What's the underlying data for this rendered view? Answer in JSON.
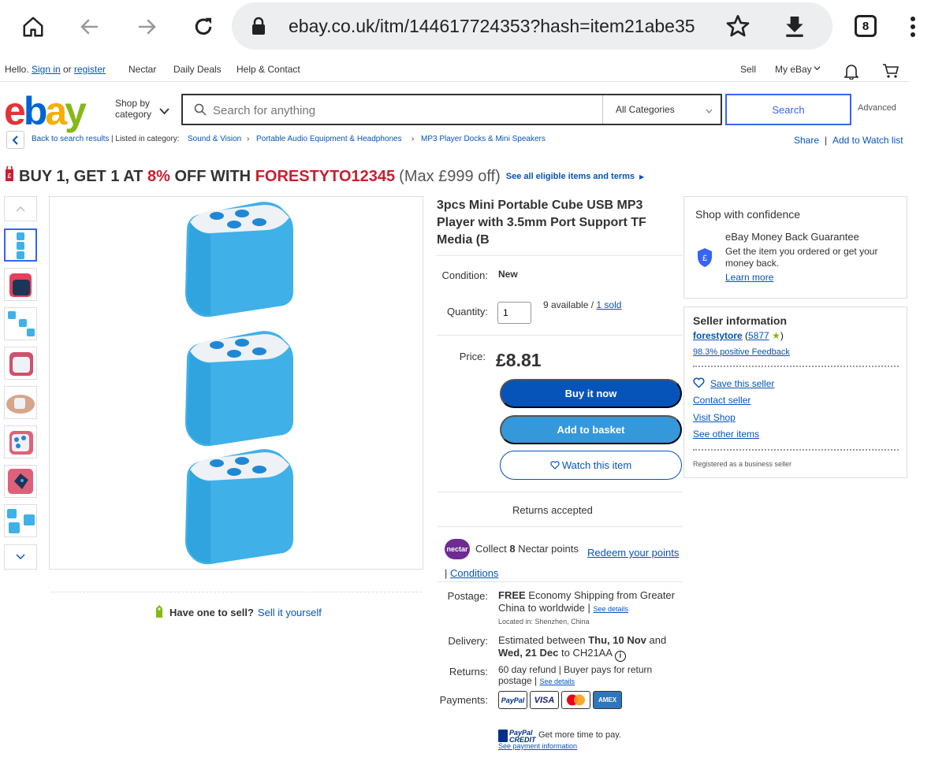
{
  "browser": {
    "url": "ebay.co.uk/itm/144617724353?hash=item21abe35",
    "tab_count": "8",
    "icons": [
      "home-icon",
      "back-arrow-icon",
      "forward-arrow-icon",
      "reload-icon",
      "lock-icon",
      "star-icon",
      "download-icon",
      "tabs-icon",
      "more-vert-icon"
    ]
  },
  "topnav": {
    "hello": "Hello.",
    "sign_in": "Sign in",
    "or": "or",
    "register": "register",
    "nectar": "Nectar",
    "daily_deals": "Daily Deals",
    "help": "Help & Contact",
    "sell": "Sell",
    "my_ebay": "My eBay"
  },
  "header": {
    "logo_letters": [
      "e",
      "b",
      "a",
      "y"
    ],
    "logo_colors": [
      "#e53238",
      "#0064d2",
      "#f5af02",
      "#86b817"
    ],
    "shop_by": "Shop by",
    "category": "category",
    "search_placeholder": "Search for anything",
    "all_categories": "All Categories",
    "search_button": "Search",
    "advanced": "Advanced"
  },
  "breadcrumb": {
    "back": "Back to search results",
    "listed_in": "Listed in category:",
    "items": [
      "Sound & Vision",
      "Portable Audio Equipment & Headphones",
      "MP3 Player Docks & Mini Speakers"
    ],
    "share": "Share",
    "watch": "Add to Watch list"
  },
  "promo": {
    "part1": "BUY 1, GET 1 AT",
    "pct": "8%",
    "part2": "OFF WITH",
    "code": "FORESTYTO12345",
    "max": "(Max £999 off)",
    "terms": "See all eligible items and terms"
  },
  "sell_banner": {
    "question": "Have one to sell?",
    "link": "Sell it yourself"
  },
  "item": {
    "title": "3pcs Mini Portable Cube USB MP3 Player with 3.5mm Port Support TF Media (B",
    "condition_label": "Condition:",
    "condition_value": "New",
    "quantity_label": "Quantity:",
    "quantity_value": "1",
    "available": "9 available /",
    "sold": "1 sold",
    "price_label": "Price:",
    "price": "£8.81",
    "buy_now": "Buy it now",
    "add_basket": "Add to basket",
    "watch": "Watch this item",
    "returns_accepted": "Returns accepted",
    "nectar_badge": "nectar",
    "nectar_collect": "Collect",
    "nectar_points": "8",
    "nectar_text": "Nectar points",
    "nectar_redeem": "Redeem your points",
    "nectar_conditions": "Conditions",
    "postage_label": "Postage:",
    "postage_free": "FREE",
    "postage_text": "Economy Shipping from Greater China to worldwide |",
    "postage_details": "See details",
    "located": "Located in: Shenzhen, China",
    "delivery_label": "Delivery:",
    "delivery_text1": "Estimated between",
    "delivery_date1": "Thu, 10 Nov",
    "delivery_and": "and",
    "delivery_date2": "Wed, 21 Dec",
    "delivery_to": "to CH21AA",
    "returns_label": "Returns:",
    "returns_text": "60 day refund | Buyer pays for return postage |",
    "returns_details": "See details",
    "payments_label": "Payments:",
    "payment_methods": [
      "PayPal",
      "VISA",
      "",
      "AMEX"
    ],
    "paypal_credit1": "PayPal",
    "paypal_credit2": "CREDIT",
    "paypal_more": "Get more time to pay.",
    "payment_info": "See payment information"
  },
  "confidence": {
    "title": "Shop with confidence",
    "guarantee": "eBay Money Back Guarantee",
    "desc": "Get the item you ordered or get your money back.",
    "learn": "Learn more",
    "shield_symbol": "£"
  },
  "seller": {
    "title": "Seller information",
    "name": "forestytore",
    "score": "5877",
    "open": "(",
    "close": ")",
    "feedback": "98.3% positive Feedback",
    "save": "Save this seller",
    "contact": "Contact seller",
    "visit": "Visit Shop",
    "other": "See other items",
    "registered": "Registered as a business seller"
  },
  "colors": {
    "cube_blue": "#3fb0e8",
    "cube_top": "#eef1f5",
    "hole": "#1e88d6",
    "promo_red": "#c81f2f",
    "link": "#0654ba",
    "buy_now": "#0654ba",
    "add_basket": "#3498db"
  }
}
